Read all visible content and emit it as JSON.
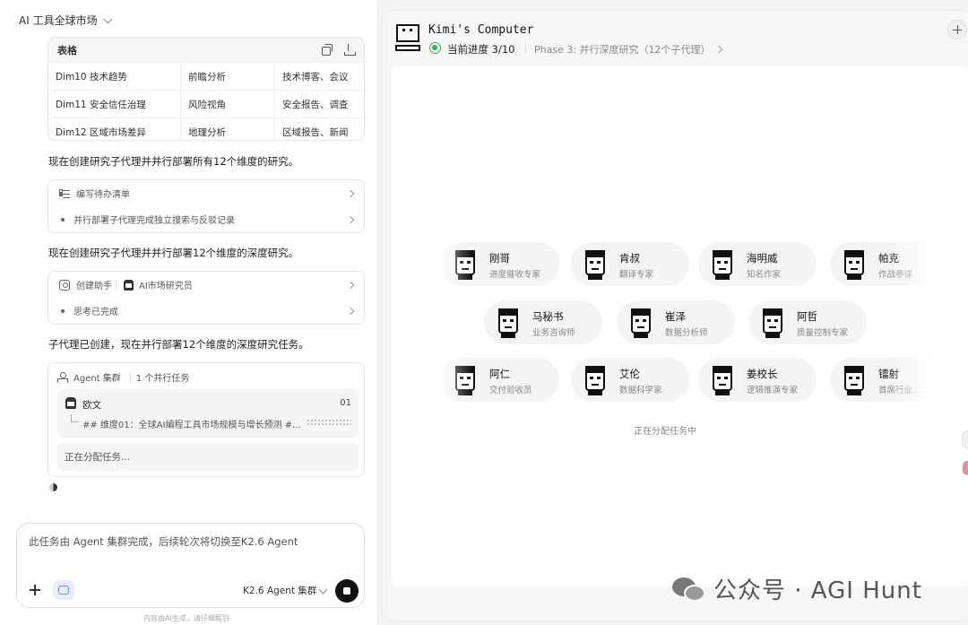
{
  "chat": {
    "title": "AI 工具全球市场",
    "table": {
      "header": "表格",
      "rows": [
        {
          "dim": "Dim10 技术趋势",
          "view": "前瞻分析",
          "source": "技术博客、会议"
        },
        {
          "dim": "Dim11 安全信任治理",
          "view": "风险视角",
          "source": "安全报告、调查"
        },
        {
          "dim": "Dim12 区域市场差异",
          "view": "地理分析",
          "source": "区域报告、新闻"
        }
      ]
    },
    "msg1": "现在创建研究子代理并并行部署所有12个维度的研究。",
    "todo": {
      "title": "编写待办清单",
      "item": "并行部署子代理完成独立搜索与反驳记录"
    },
    "msg2": "现在创建研究子代理并并行部署12个维度的深度研究。",
    "helper": {
      "title": "创建助手",
      "agent": "AI市场研究员",
      "item": "思考已完成"
    },
    "msg3": "子代理已创建，现在并行部署12个维度的深度研究任务。",
    "cluster": {
      "title": "Agent 集群",
      "count": "1 个并行任务",
      "agent_name": "欧文",
      "agent_num": "01",
      "agent_task": "## 维度01：全球AI编程工具市场规模与增长预测 #...",
      "assigning": "正在分配任务..."
    },
    "input": {
      "text": "此任务由 Agent 集群完成，后续轮次将切换至K2.6 Agent",
      "model": "K2.6 Agent 集群"
    },
    "disclaimer": "内容由AI生成，请仔细甄别"
  },
  "computer": {
    "title": "Kimi's Computer",
    "progress": "当前进度 3/10",
    "phase": "Phase 3: 并行深度研究（12个子代理）",
    "status": "正在分配任务中",
    "agents_row1": [
      {
        "name": "刚哥",
        "role": "进度催收专家"
      },
      {
        "name": "肯叔",
        "role": "翻译专家"
      },
      {
        "name": "海明威",
        "role": "知名作家"
      },
      {
        "name": "帕克",
        "role": "作战参谋"
      }
    ],
    "agents_row2": [
      {
        "name": "马秘书",
        "role": "业务咨询师"
      },
      {
        "name": "崔泽",
        "role": "数据分析师"
      },
      {
        "name": "阿哲",
        "role": "质量控制专家"
      }
    ],
    "agents_row3": [
      {
        "name": "阿仁",
        "role": "交付验收员"
      },
      {
        "name": "艾伦",
        "role": "数据科学家"
      },
      {
        "name": "姜校长",
        "role": "逻辑推演专家"
      },
      {
        "name": "镭射",
        "role": "首席行业..."
      }
    ]
  },
  "watermark": "公众号 · AGI Hunt"
}
